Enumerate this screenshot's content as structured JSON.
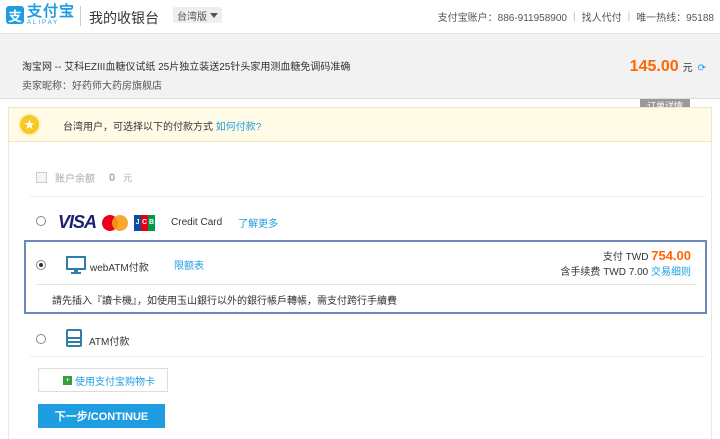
{
  "header": {
    "logo_cn": "支付宝",
    "logo_en": "ALIPAY",
    "logo_mark": "支",
    "title": "我的收银台",
    "region": "台湾版",
    "account": "支付宝账户：886-911958900",
    "find_payer": "找人代付",
    "hotline": "唯一热线：95188"
  },
  "order": {
    "description": "淘宝网 -- 艾科EZIII血糖仪试纸 25片独立装送25针头家用测血糖免调码准确",
    "seller": "卖家昵称：好药师大药房旗舰店",
    "amount": "145.00",
    "unit": "元",
    "detail_tab": "订单详情"
  },
  "tip": {
    "text": "台湾用户，可选择以下的付款方式",
    "link": "如何付款?"
  },
  "balance": {
    "label": "账户余额",
    "value": "0",
    "unit": "元"
  },
  "credit_card": {
    "visa": "VISA",
    "jcb": [
      "J",
      "C",
      "B"
    ],
    "label": "Credit Card",
    "learn_more": "了解更多"
  },
  "webatm": {
    "label": "webATM付款",
    "limit_link": "限额表",
    "pay_prefix": "支付 TWD",
    "pay_amount": "754.00",
    "fee_text": "含手续费 TWD 7.00",
    "rules_link": "交易细则",
    "notice": "請先插入『讀卡機』，如使用玉山銀行以外的銀行帳戶轉帳，需支付跨行手續費"
  },
  "atm": {
    "label": "ATM付款"
  },
  "gift_card": {
    "label": "使用支付宝购物卡"
  },
  "next_button": "下一步/CONTINUE",
  "colors": {
    "brand": "#1e9ee1",
    "price": "#ff6600",
    "selected_border": "#6c88b9"
  }
}
